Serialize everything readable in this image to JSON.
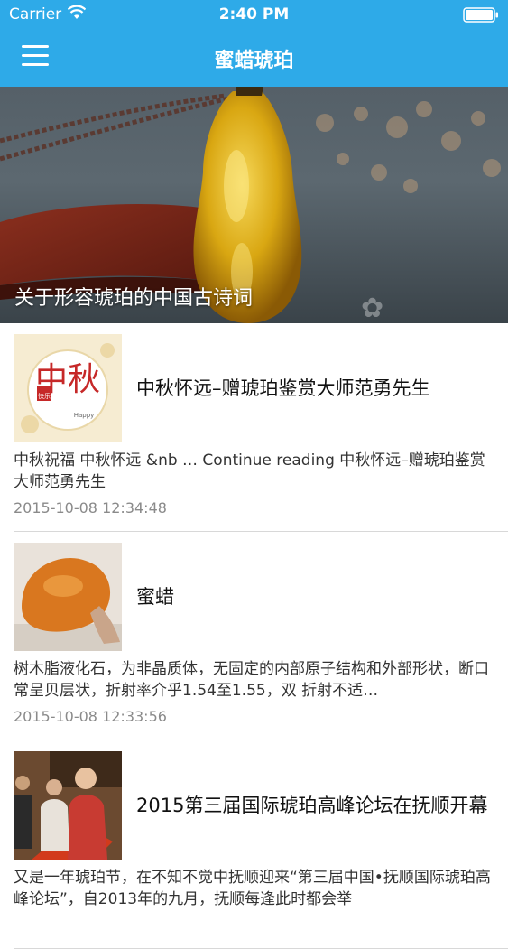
{
  "status": {
    "carrier": "Carrier",
    "time": "2:40 PM"
  },
  "nav": {
    "title": "蜜蜡琥珀"
  },
  "hero": {
    "caption": "关于形容琥珀的中国古诗词"
  },
  "posts": [
    {
      "title": "中秋怀远–赠琥珀鉴赏大师范勇先生",
      "excerpt": "  中秋祝福 中秋怀远      &nb … Continue reading 中秋怀远–赠琥珀鉴赏大师范勇先生",
      "date": "2015-10-08 12:34:48",
      "thumb": {
        "text_big": "中秋",
        "text_small": "快乐",
        "text_en": "Happy"
      }
    },
    {
      "title": "蜜蜡",
      "excerpt": "树木脂液化石，为非晶质体，无固定的内部原子结构和外部形状，断口常呈贝层状，折射率介乎1.54至1.55，双 折射不适…",
      "date": "2015-10-08 12:33:56"
    },
    {
      "title": "2015第三届国际琥珀高峰论坛在抚顺开幕",
      "excerpt": "又是一年琥珀节，在不知不觉中抚顺迎来“第三届中国•抚顺国际琥珀高峰论坛”，自2013年的九月，抚顺每逢此时都会举",
      "date": ""
    }
  ]
}
